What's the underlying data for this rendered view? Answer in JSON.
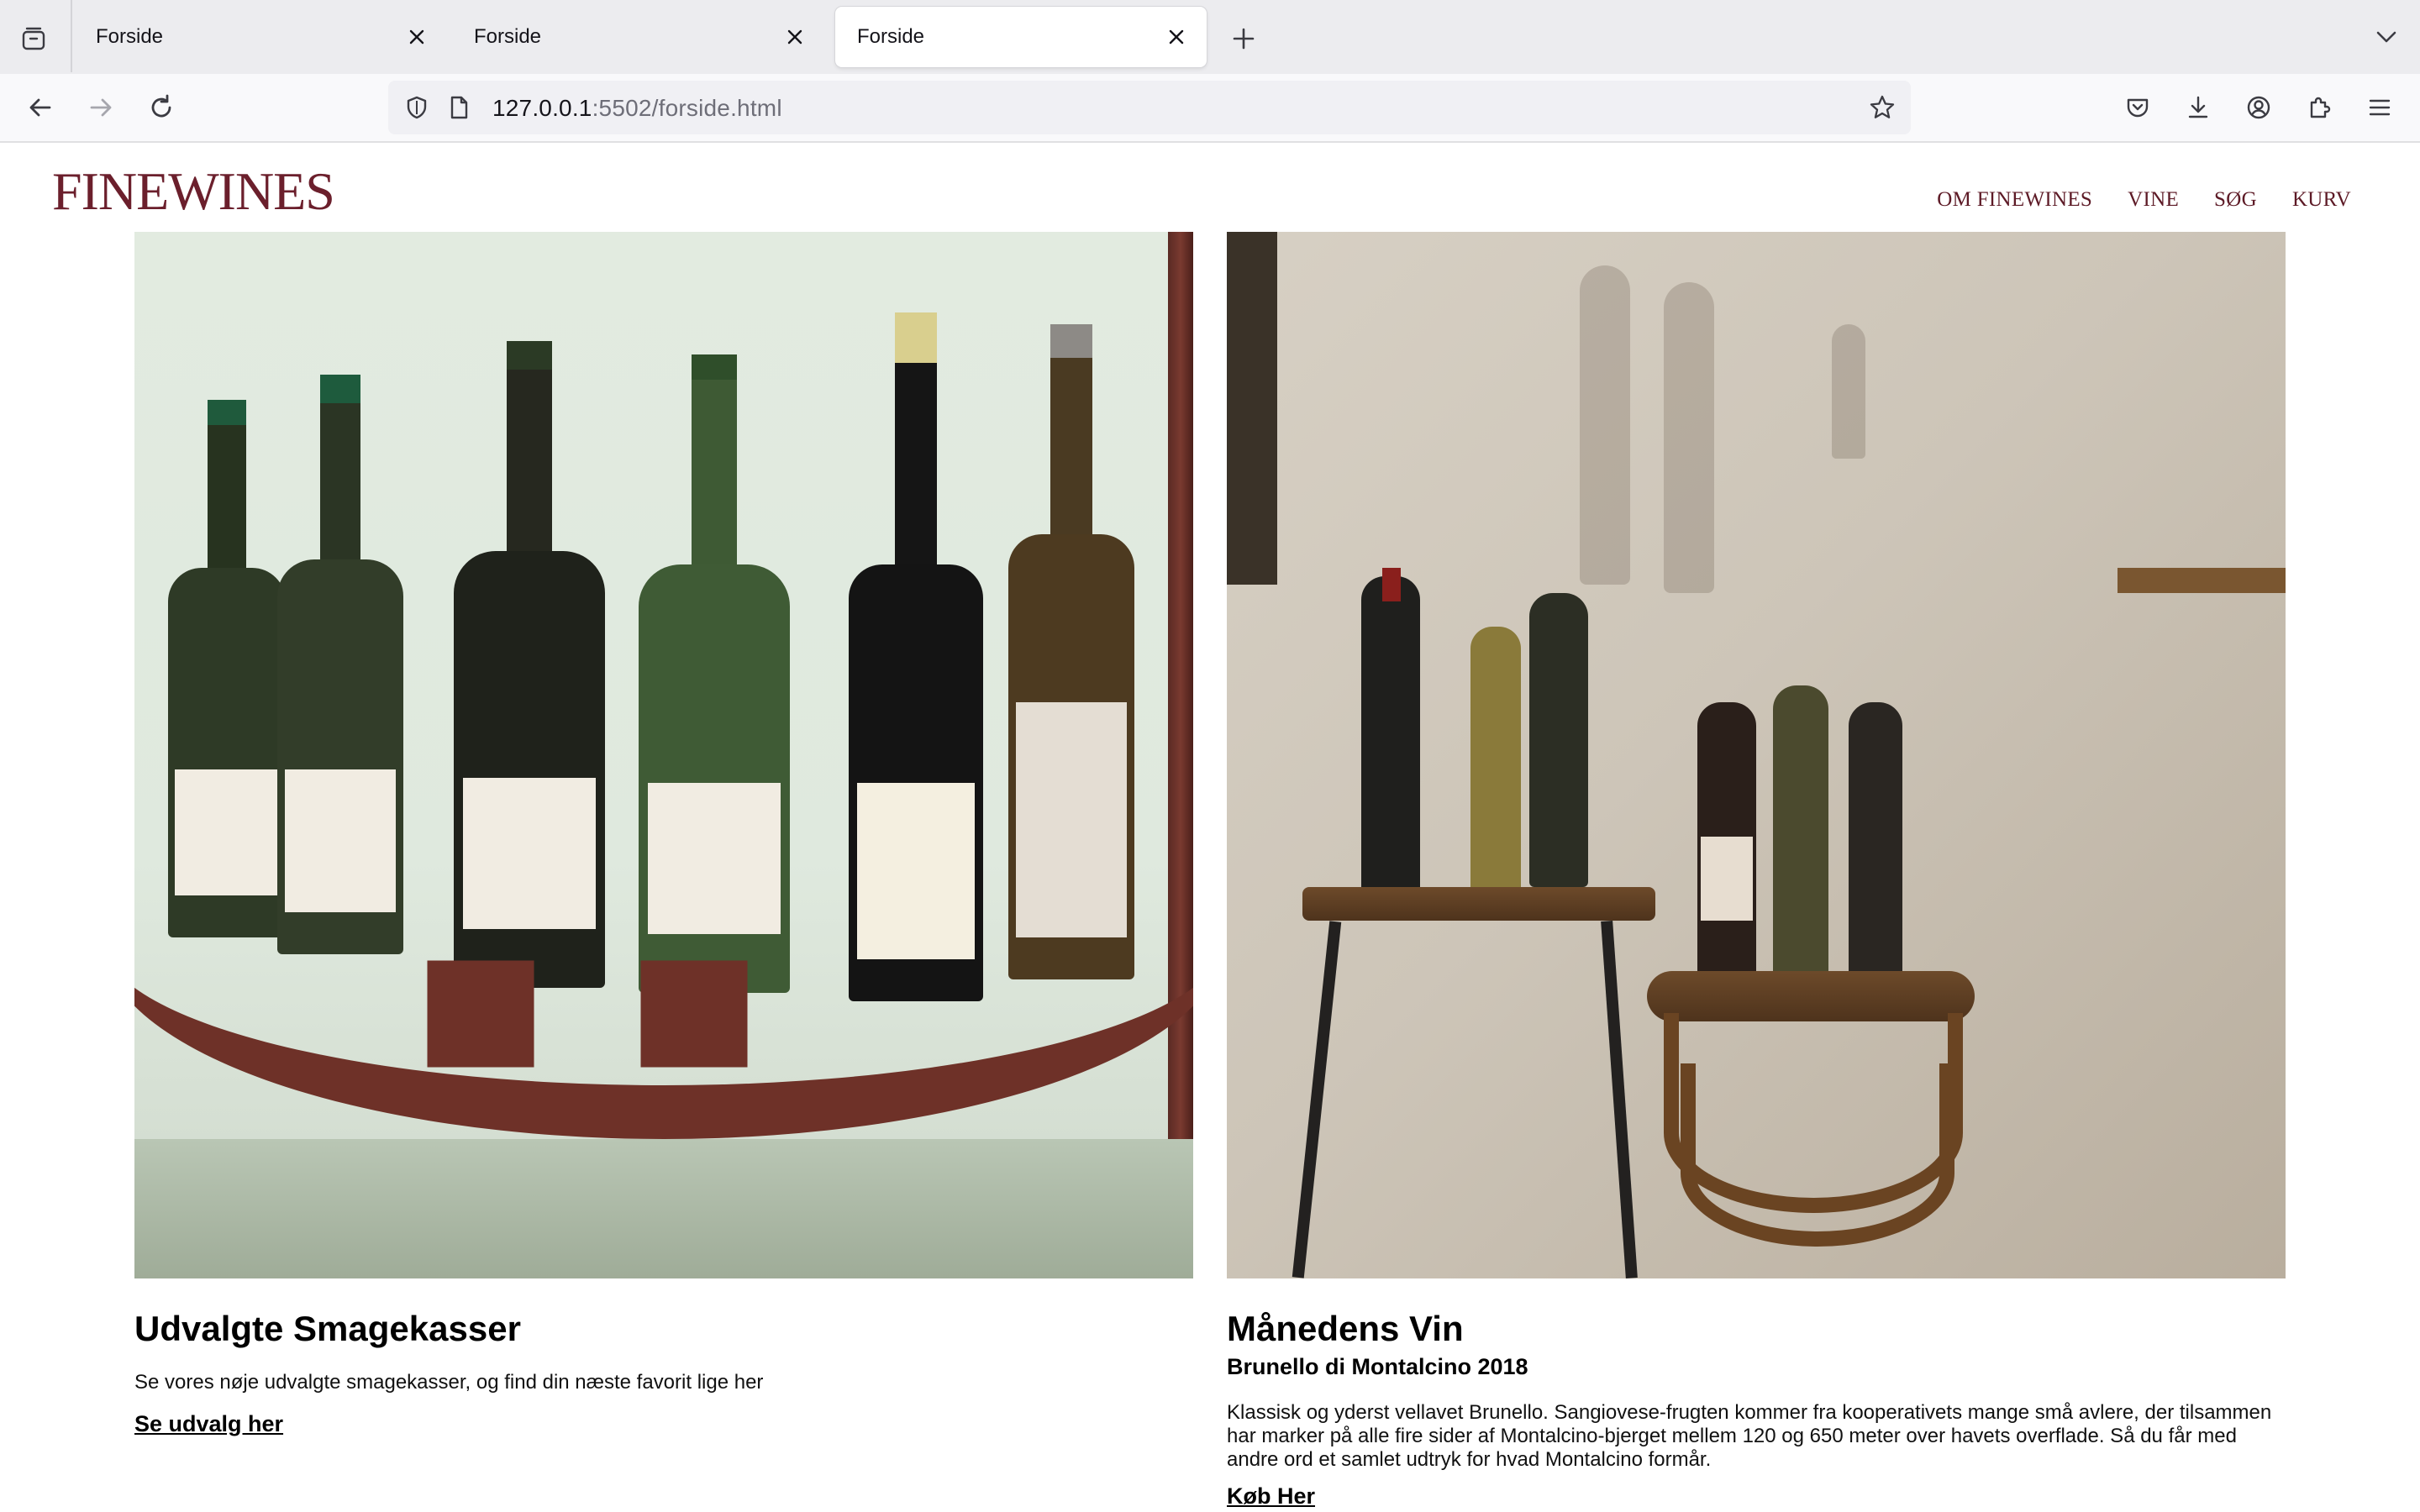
{
  "browser": {
    "tabs": [
      {
        "title": "Forside",
        "active": false
      },
      {
        "title": "Forside",
        "active": false
      },
      {
        "title": "Forside",
        "active": true
      }
    ],
    "url_host": "127.0.0.1",
    "url_rest": ":5502/forside.html",
    "icons": [
      "tab-overview-icon",
      "close-icon",
      "plus-icon",
      "chevron-down-icon",
      "back-arrow-icon",
      "forward-arrow-icon",
      "reload-icon",
      "shield-icon",
      "page-icon",
      "star-icon",
      "pocket-icon",
      "download-icon",
      "account-icon",
      "extensions-icon",
      "menu-icon"
    ]
  },
  "site": {
    "logo": "FINEWINES",
    "nav": [
      "OM FINEWINES",
      "VINE",
      "SØG",
      "KURV"
    ],
    "brand_color": "#6b1f2c"
  },
  "cards": {
    "left": {
      "title": "Udvalgte Smagekasser",
      "text": "Se vores nøje udvalgte smagekasser, og find din næste favorit lige her",
      "link": "Se udvalg her"
    },
    "right": {
      "title": "Månedens Vin",
      "subtitle": "Brunello di Montalcino 2018",
      "text": "Klassisk og yderst vellavet Brunello. Sangiovese-frugten kommer fra kooperativets mange små avlere, der tilsammen har marker på alle fire sider af Montalcino-bjerget mellem 120 og 650 meter over havets overflade. Så du får med andre ord et samlet udtryk for hvad Montalcino formår.",
      "link": "Køb Her"
    }
  }
}
